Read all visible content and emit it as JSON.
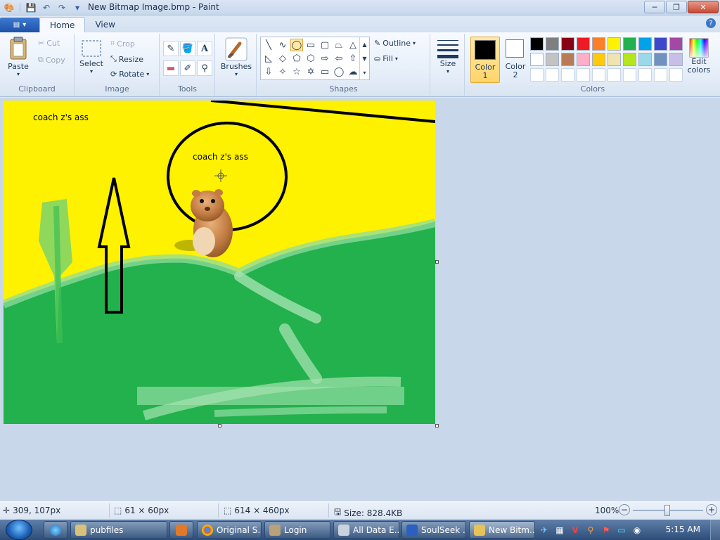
{
  "window": {
    "title": "New Bitmap Image.bmp - Paint",
    "minimize_glyph": "─",
    "maximize_glyph": "❐",
    "close_glyph": "✕"
  },
  "tabs": {
    "home": "Home",
    "view": "View"
  },
  "clipboard": {
    "paste": "Paste",
    "cut": "Cut",
    "copy": "Copy",
    "label": "Clipboard"
  },
  "image": {
    "select": "Select",
    "crop": "Crop",
    "resize": "Resize",
    "rotate": "Rotate",
    "label": "Image"
  },
  "tools": {
    "label": "Tools",
    "text_glyph": "A"
  },
  "brushes": {
    "label": "Brushes"
  },
  "shapes": {
    "outline": "Outline",
    "fill": "Fill",
    "label": "Shapes"
  },
  "size": {
    "label": "Size"
  },
  "colors": {
    "color1_line1": "Color",
    "color1_line2": "1",
    "color2_line1": "Color",
    "color2_line2": "2",
    "edit_line1": "Edit",
    "edit_line2": "colors",
    "label": "Colors",
    "selected_color1": "#000000",
    "selected_color2": "#ffffff",
    "palette_row1": [
      "#000000",
      "#7f7f7f",
      "#880015",
      "#ed1c24",
      "#ff7f27",
      "#fff200",
      "#22b14c",
      "#00a2e8",
      "#3f48cc",
      "#a349a4"
    ],
    "palette_row2": [
      "#ffffff",
      "#c3c3c3",
      "#b97a57",
      "#ffaec9",
      "#ffc90e",
      "#efe4b0",
      "#b5e61d",
      "#99d9ea",
      "#7092be",
      "#c8bfe7"
    ],
    "palette_row3": [
      "#ffffff",
      "#ffffff",
      "#ffffff",
      "#ffffff",
      "#ffffff",
      "#ffffff",
      "#ffffff",
      "#ffffff",
      "#ffffff",
      "#ffffff"
    ]
  },
  "canvas": {
    "background": "#fff200",
    "green": "#22b14c",
    "text1": "coach z's ass",
    "text2": "coach z's ass"
  },
  "status": {
    "cursor_pos": "309, 107px",
    "selection_size": "61 × 60px",
    "image_size": "614 × 460px",
    "file_size": "Size: 828.4KB",
    "zoom": "100%",
    "zoom_out": "−",
    "zoom_in": "+"
  },
  "taskbar": {
    "items": [
      "pubfiles",
      "Original S...",
      "Login",
      "All Data E...",
      "SoulSeek ...",
      "New Bitm..."
    ],
    "clock": "5:15 AM"
  }
}
